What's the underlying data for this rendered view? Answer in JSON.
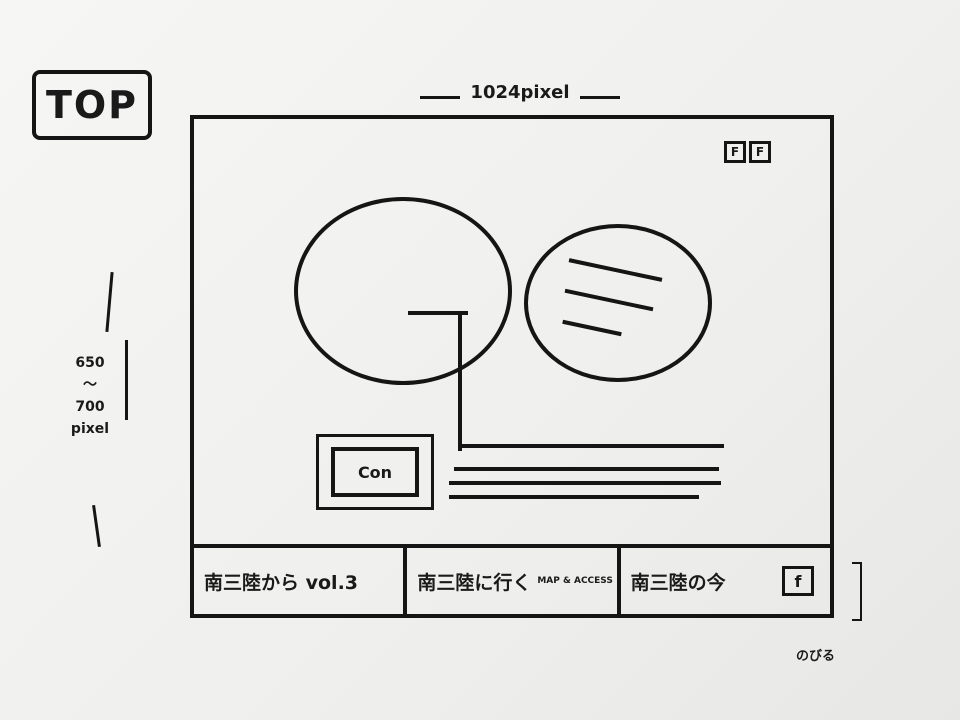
{
  "annotations": {
    "page_label": "TOP",
    "width_label": "1024pixel",
    "height_label": [
      "650",
      "〜",
      "700",
      "pixel"
    ],
    "stretch_note": "のびる"
  },
  "header": {
    "social_icons": [
      "F",
      "F"
    ]
  },
  "banner": {
    "label": "Con"
  },
  "tabs": [
    {
      "label": "南三陸から vol.3"
    },
    {
      "label": "南三陸に行く",
      "sub": "MAP & ACCESS"
    },
    {
      "label": "南三陸の今",
      "icon": "f"
    }
  ]
}
